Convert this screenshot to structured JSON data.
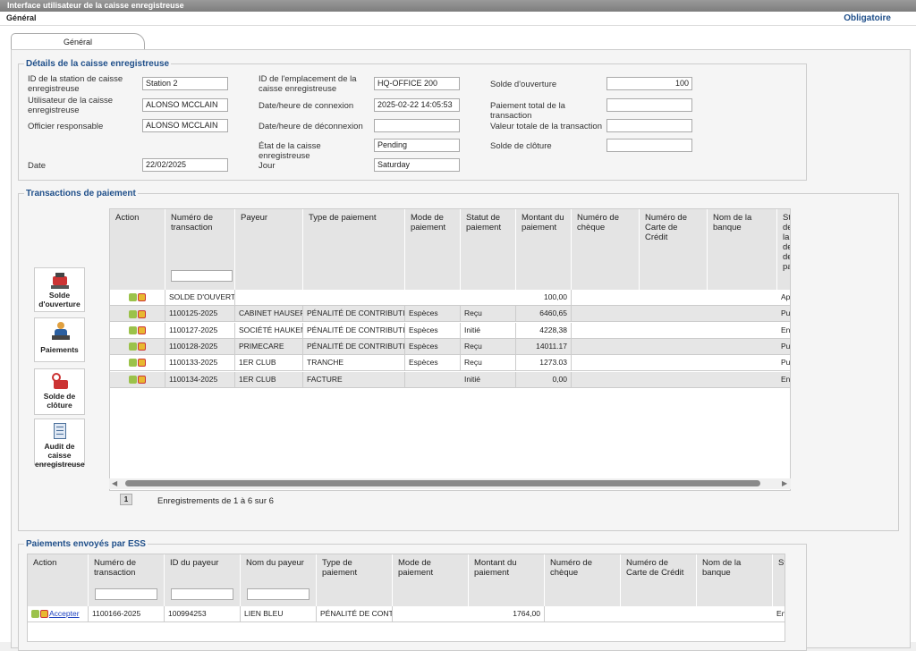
{
  "window": {
    "title": "Interface utilisateur de la caisse enregistreuse"
  },
  "subheader": {
    "label": "Général",
    "required": "Obligatoire"
  },
  "tab": {
    "label": "Général"
  },
  "details": {
    "legend": "Détails de la caisse enregistreuse",
    "station_label": "ID de la station de caisse enregistreuse",
    "station_value": "Station 2",
    "user_label": "Utilisateur de la caisse enregistreuse",
    "user_value": "ALONSO MCCLAIN",
    "officer_label": "Officier responsable",
    "officer_value": "ALONSO MCCLAIN",
    "date_label": "Date",
    "date_value": "22/02/2025",
    "location_label": "ID de l'emplacement de la caisse enregistreuse",
    "location_value": "HQ-OFFICE 200",
    "login_label": "Date/heure de connexion",
    "login_value": "2025-02-22 14:05:53",
    "logout_label": "Date/heure de déconnexion",
    "logout_value": "",
    "state_label": "État de la caisse enregistreuse",
    "state_value": "Pending",
    "day_label": "Jour",
    "day_value": "Saturday",
    "opening_label": "Solde d'ouverture",
    "opening_value": "100",
    "total_payment_label": "Paiement total de la transaction",
    "total_payment_value": "",
    "total_value_label": "Valeur totale de la transaction",
    "total_value_value": "",
    "closing_label": "Solde de clôture",
    "closing_value": ""
  },
  "transactions": {
    "legend": "Transactions de paiement",
    "columns": [
      "Action",
      "Numéro de transaction",
      "Payeur",
      "Type de paiement",
      "Mode de paiement",
      "Statut de paiement",
      "Montant du paiement",
      "Numéro de chèque",
      "Numéro de Carte de Crédit",
      "Nom de la banque",
      "Statut de la demande de paie"
    ],
    "rows": [
      {
        "txn": "SOLDE D'OUVERTURE",
        "payer": "",
        "type": "",
        "mode": "",
        "status": "",
        "amount": "100,00",
        "cheque": "",
        "card": "",
        "bank": "",
        "req": "Approuvé"
      },
      {
        "txn": "1100125-2025",
        "payer": "CABINET HAUSERMANN",
        "type": "PÉNALITÉ DE CONTRIBUTION",
        "mode": "Espèces",
        "status": "Reçu",
        "amount": "6460,65",
        "cheque": "",
        "card": "",
        "bank": "",
        "req": "Publié"
      },
      {
        "txn": "1100127-2025",
        "payer": "SOCIÉTÉ HAUKEN",
        "type": "PÉNALITÉ DE CONTRIBUTION",
        "mode": "Espèces",
        "status": "Initié",
        "amount": "4228,38",
        "cheque": "",
        "card": "",
        "bank": "",
        "req": "En attente"
      },
      {
        "txn": "1100128-2025",
        "payer": "PRIMECARE",
        "type": "PÉNALITÉ DE CONTRIBUTION",
        "mode": "Espèces",
        "status": "Reçu",
        "amount": "14011.17",
        "cheque": "",
        "card": "",
        "bank": "",
        "req": "Publié"
      },
      {
        "txn": "1100133-2025",
        "payer": "1ER CLUB",
        "type": "TRANCHE",
        "mode": "Espèces",
        "status": "Reçu",
        "amount": "1273.03",
        "cheque": "",
        "card": "",
        "bank": "",
        "req": "Publié"
      },
      {
        "txn": "1100134-2025",
        "payer": "1ER CLUB",
        "type": "FACTURE",
        "mode": "",
        "status": "Initié",
        "amount": "0,00",
        "cheque": "",
        "card": "",
        "bank": "",
        "req": "En attente"
      }
    ],
    "page": "1",
    "records": "Enregistrements de 1 à 6 sur 6"
  },
  "sidebar": {
    "opening": "Solde d'ouverture",
    "payments": "Paiements",
    "closing": "Solde de clôture",
    "audit": "Audit de caisse enregistreuse"
  },
  "ess": {
    "legend": "Paiements envoyés par ESS",
    "columns": [
      "Action",
      "Numéro de transaction",
      "ID du payeur",
      "Nom du payeur",
      "Type de paiement",
      "Mode de paiement",
      "Montant du paiement",
      "Numéro de chèque",
      "Numéro de Carte de Crédit",
      "Nom de la banque",
      "St"
    ],
    "accept": "Accepter",
    "rows": [
      {
        "txn": "1100166-2025",
        "payer_id": "100994253",
        "payer_name": "LIEN BLEU",
        "type": "PÉNALITÉ DE CONTRIBUTION",
        "mode": "",
        "amount": "1764,00",
        "cheque": "",
        "card": "",
        "bank": "",
        "status": "En attente"
      }
    ]
  },
  "colors": {
    "accent": "#1f4f8a",
    "header_bg": "#e4e4e4",
    "row_alt": "#e6e6e6"
  }
}
